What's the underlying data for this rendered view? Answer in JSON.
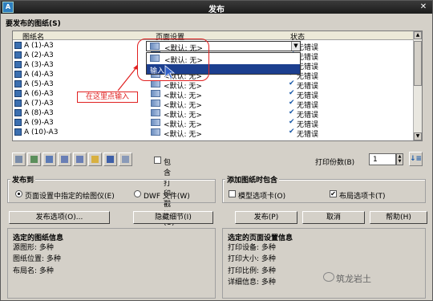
{
  "window": {
    "title": "发布",
    "app_icon_text": "A"
  },
  "sheets_section": {
    "label": "要发布的图纸(S)",
    "columns": [
      "图纸名",
      "页面设置",
      "状态"
    ],
    "rows": [
      {
        "name": "A (1)-A3",
        "setup": "<默认: 无>",
        "status": "无错误"
      },
      {
        "name": "A (2)-A3",
        "setup": "<默认: 无>",
        "status": "无错误"
      },
      {
        "name": "A (3)-A3",
        "setup": "<默认: 无>",
        "status": "无错误"
      },
      {
        "name": "A (4)-A3",
        "setup": "<默认: 无>",
        "status": "无错误"
      },
      {
        "name": "A (5)-A3",
        "setup": "<默认: 无>",
        "status": "无错误"
      },
      {
        "name": "A (6)-A3",
        "setup": "<默认: 无>",
        "status": "无错误"
      },
      {
        "name": "A (7)-A3",
        "setup": "<默认: 无>",
        "status": "无错误"
      },
      {
        "name": "A (8)-A3",
        "setup": "<默认: 无>",
        "status": "无错误"
      },
      {
        "name": "A (9)-A3",
        "setup": "<默认: 无>",
        "status": "无错误"
      },
      {
        "name": "A (10)-A3",
        "setup": "<默认: 无>",
        "status": "无错误"
      }
    ],
    "dropdown_value": "<默认: 无>",
    "popup_items": [
      "<默认: 无>",
      "输入..."
    ],
    "callout_text": "在这里点输入"
  },
  "toolbar": {
    "include_stamp_label": "包含打印戳记(U)",
    "copies_label": "打印份数(B)",
    "copies_value": "1"
  },
  "publish_to": {
    "label": "发布到",
    "option1": "页面设置中指定的绘图仪(E)",
    "option2": "DWF 文件(W)"
  },
  "add_sheets": {
    "label": "添加图纸时包含",
    "model_tab": "模型选项卡(O)",
    "layout_tab": "布局选项卡(T)"
  },
  "buttons": {
    "publish_options": "发布选项(O)...",
    "hide_details": "隐藏细节(I)",
    "publish": "发布(P)",
    "cancel": "取消",
    "help": "帮助(H)"
  },
  "sheet_info": {
    "label": "选定的图纸信息",
    "source_drawing": "源图形:  多种",
    "drawing_location": "图纸位置:  多种",
    "layout_name": "布局名:  多种"
  },
  "setup_info": {
    "label": "选定的页面设置信息",
    "plot_device": "打印设备:  多种",
    "plot_size": "打印大小:  多种",
    "plot_scale": "打印比例:  多种",
    "details": "详细信息:  多种"
  },
  "watermark": "筑龙岩土"
}
